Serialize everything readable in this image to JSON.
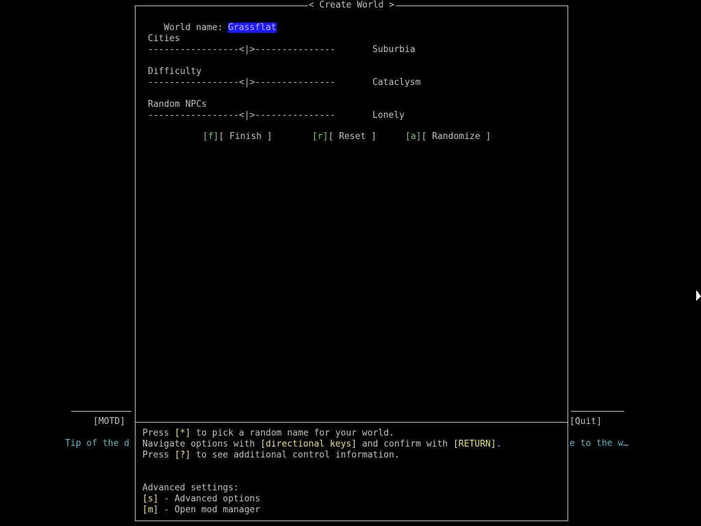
{
  "background": {
    "motd_label": "[MOTD]",
    "quit_label": "[Quit]",
    "tip_left": "Tip of the d",
    "tip_right": "e to the w…"
  },
  "dialog": {
    "title": "< Create World >",
    "world_name_label": "World name: ",
    "world_name_value": "Grassflat",
    "options": [
      {
        "label": "Cities",
        "slider": "-----------------<|>---------------",
        "value": "Suburbia"
      },
      {
        "label": "Difficulty",
        "slider": "-----------------<|>---------------",
        "value": "Cataclysm"
      },
      {
        "label": "Random NPCs",
        "slider": "-----------------<|>---------------",
        "value": "Lonely"
      }
    ],
    "buttons": {
      "finish_key": "[f]",
      "finish_label": "[ Finish ]",
      "reset_key": "[r]",
      "reset_label": "[ Reset ]",
      "randomize_key": "[a]",
      "randomize_label": "[ Randomize ]"
    },
    "help": {
      "line1_pre": "Press ",
      "line1_key": "[*]",
      "line1_post": " to pick a random name for your world.",
      "line2_pre": "Navigate options with ",
      "line2_key1": "[directional keys]",
      "line2_mid": " and confirm with ",
      "line2_key2": "[RETURN]",
      "line2_post": ".",
      "line3_pre": "Press ",
      "line3_key": "[?]",
      "line3_post": " to see additional control information.",
      "advanced_title": "Advanced settings:",
      "adv1_key": "[s]",
      "adv1_text": " - Advanced options",
      "adv2_key": "[m]",
      "adv2_text": " - Open mod manager"
    }
  },
  "colors": {
    "background": "#000000",
    "text": "#c0c0c0",
    "hotkey": "#6fcf6f",
    "highlight_bg": "#1a1aff",
    "tip": "#5fb7c7"
  }
}
